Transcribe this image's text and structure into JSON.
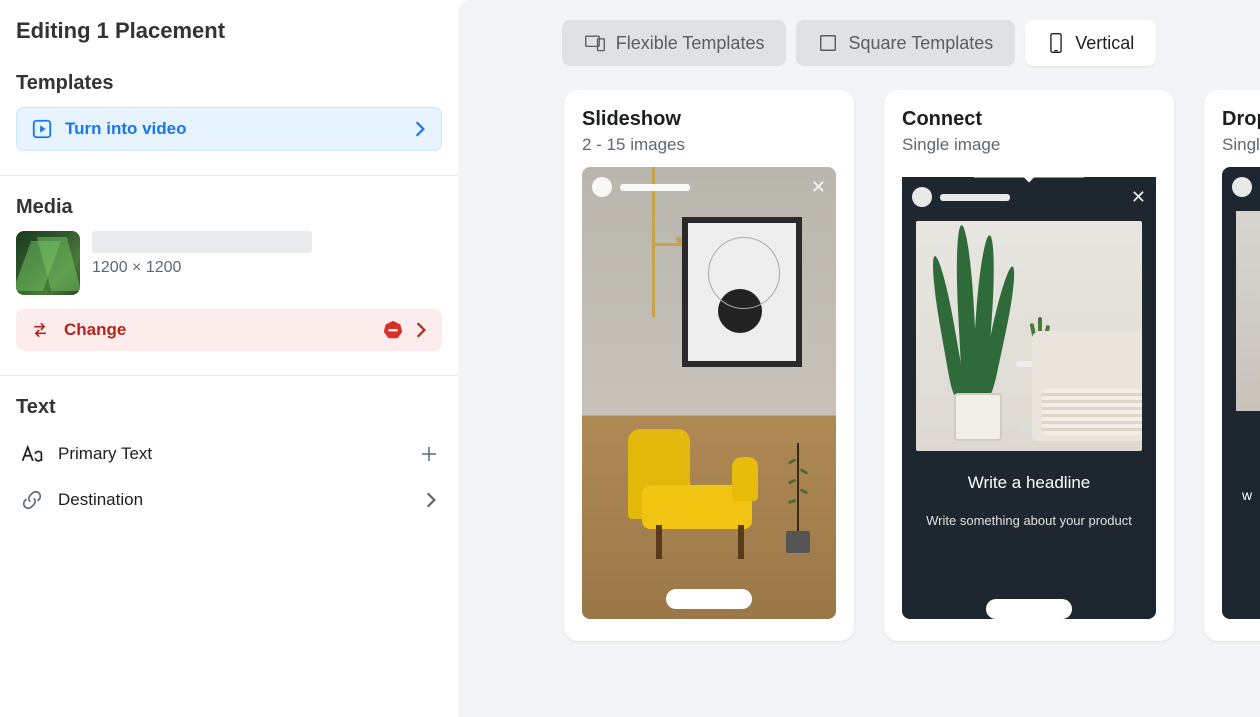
{
  "page_title": "Editing 1 Placement",
  "sections": {
    "templates_label": "Templates",
    "media_label": "Media",
    "text_label": "Text"
  },
  "turn_into_video": {
    "label": "Turn into video"
  },
  "media": {
    "dimensions": "1200 × 1200",
    "change_label": "Change"
  },
  "text_items": {
    "primary": "Primary Text",
    "destination": "Destination"
  },
  "tabs": {
    "flexible": "Flexible Templates",
    "square": "Square Templates",
    "vertical": "Vertical"
  },
  "cards": {
    "slideshow": {
      "title": "Slideshow",
      "subtitle": "2 - 15 images"
    },
    "connect": {
      "title": "Connect",
      "subtitle": "Single image",
      "headline": "Write a headline",
      "subhead": "Write something about your product"
    },
    "drop": {
      "title": "Drop",
      "subtitle": "Singl",
      "body_fragment": "w"
    }
  },
  "colors": {
    "accent_blue": "#1877f2",
    "danger_red": "#b3261e",
    "panel_bg": "#f3f4f6"
  }
}
